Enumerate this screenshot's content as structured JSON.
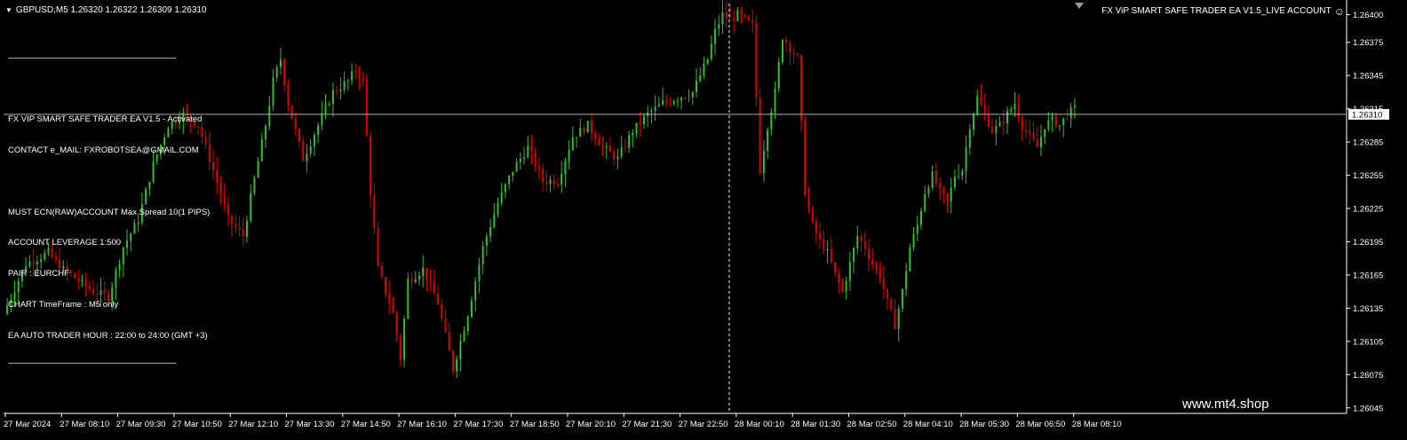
{
  "header": {
    "symbol_label": "GBPUSD,M5  1.26320 1.26322 1.26309 1.26310",
    "ea_title": "FX ViP SMART SAFE TRADER EA V1.5_LIVE ACCOUNT"
  },
  "info_panel": {
    "separator": "-----------------------------------------------------------------------",
    "lines": [
      "FX VIP SMART SAFE TRADER EA V1.5 - Activated",
      "CONTACT e_MAIL: FXROBOTSEA@GMAIL.COM",
      "",
      "MUST ECN(RAW)ACCOUNT Max Spread 10(1 PIPS)",
      "ACCOUNT LEVERAGE 1:500",
      "PAIR : EURCHF",
      "CHART TimeFrame : M5 only",
      "EA AUTO TRADER HOUR : 22:00 to 24:00 (GMT +3)"
    ]
  },
  "watermark": "www.mt4.shop",
  "colors": {
    "background": "#000000",
    "bull": "#2fbf2f",
    "bear": "#e00000",
    "axis": "#ffffff",
    "price_line": "#b4b4b4",
    "price_tag_bg": "#ffffff",
    "price_tag_text": "#000000"
  },
  "chart_data": {
    "type": "candlestick",
    "y_axis_labels": [
      "1.26400",
      "1.26375",
      "1.26345",
      "1.26315",
      "1.26285",
      "1.26255",
      "1.26225",
      "1.26195",
      "1.26165",
      "1.26135",
      "1.26105",
      "1.26075",
      "1.26045"
    ],
    "y_axis_values": [
      1.264,
      1.26375,
      1.26345,
      1.26315,
      1.26285,
      1.26255,
      1.26225,
      1.26195,
      1.26165,
      1.26135,
      1.26105,
      1.26075,
      1.26045
    ],
    "ylim": [
      1.2604,
      1.2641
    ],
    "current_price": 1.2631,
    "current_price_label": "1.26310",
    "x_axis_labels": [
      "27 Mar 2024",
      "27 Mar 08:10",
      "27 Mar 09:30",
      "27 Mar 10:50",
      "27 Mar 12:10",
      "27 Mar 13:30",
      "27 Mar 14:50",
      "27 Mar 16:10",
      "27 Mar 17:30",
      "27 Mar 18:50",
      "27 Mar 20:10",
      "27 Mar 21:30",
      "27 Mar 22:50",
      "28 Mar 00:10",
      "28 Mar 01:30",
      "28 Mar 02:50",
      "28 Mar 04:10",
      "28 Mar 05:30",
      "28 Mar 06:50",
      "28 Mar 08:10"
    ],
    "period_separator_label": "27 Mar 22:50",
    "close_path": [
      [
        0,
        1.2613
      ],
      [
        6,
        1.26175
      ],
      [
        12,
        1.26185
      ],
      [
        16,
        1.2617
      ],
      [
        20,
        1.2616
      ],
      [
        24,
        1.2615
      ],
      [
        28,
        1.26145
      ],
      [
        32,
        1.2619
      ],
      [
        36,
        1.26215
      ],
      [
        40,
        1.26265
      ],
      [
        44,
        1.263
      ],
      [
        48,
        1.2631
      ],
      [
        52,
        1.263
      ],
      [
        56,
        1.2626
      ],
      [
        60,
        1.26215
      ],
      [
        64,
        1.262
      ],
      [
        66,
        1.26235
      ],
      [
        70,
        1.263
      ],
      [
        72,
        1.2634
      ],
      [
        74,
        1.2636
      ],
      [
        76,
        1.2632
      ],
      [
        80,
        1.2627
      ],
      [
        84,
        1.263
      ],
      [
        88,
        1.2633
      ],
      [
        92,
        1.2634
      ],
      [
        94,
        1.2635
      ],
      [
        96,
        1.2634
      ],
      [
        98,
        1.2624
      ],
      [
        100,
        1.2617
      ],
      [
        102,
        1.2615
      ],
      [
        104,
        1.2613
      ],
      [
        106,
        1.2609
      ],
      [
        108,
        1.2616
      ],
      [
        112,
        1.2617
      ],
      [
        116,
        1.2614
      ],
      [
        118,
        1.2611
      ],
      [
        120,
        1.2608
      ],
      [
        124,
        1.2613
      ],
      [
        128,
        1.2619
      ],
      [
        132,
        1.2623
      ],
      [
        136,
        1.2626
      ],
      [
        140,
        1.2628
      ],
      [
        144,
        1.2625
      ],
      [
        148,
        1.2625
      ],
      [
        152,
        1.2629
      ],
      [
        156,
        1.263
      ],
      [
        160,
        1.2628
      ],
      [
        164,
        1.2627
      ],
      [
        168,
        1.26295
      ],
      [
        172,
        1.2631
      ],
      [
        176,
        1.2632
      ],
      [
        180,
        1.26325
      ],
      [
        184,
        1.2633
      ],
      [
        186,
        1.26345
      ],
      [
        188,
        1.2636
      ],
      [
        190,
        1.26385
      ],
      [
        192,
        1.264
      ],
      [
        194,
        1.26395
      ],
      [
        196,
        1.264
      ],
      [
        198,
        1.26395
      ],
      [
        200,
        1.2639
      ],
      [
        202,
        1.2626
      ],
      [
        204,
        1.263
      ],
      [
        206,
        1.2633
      ],
      [
        208,
        1.2638
      ],
      [
        210,
        1.2637
      ],
      [
        212,
        1.2636
      ],
      [
        214,
        1.2624
      ],
      [
        216,
        1.2621
      ],
      [
        218,
        1.26195
      ],
      [
        220,
        1.26185
      ],
      [
        222,
        1.26165
      ],
      [
        224,
        1.2615
      ],
      [
        226,
        1.26175
      ],
      [
        228,
        1.262
      ],
      [
        230,
        1.2619
      ],
      [
        232,
        1.26175
      ],
      [
        234,
        1.26165
      ],
      [
        236,
        1.2614
      ],
      [
        238,
        1.2612
      ],
      [
        240,
        1.2615
      ],
      [
        242,
        1.2619
      ],
      [
        244,
        1.2621
      ],
      [
        246,
        1.2624
      ],
      [
        248,
        1.26255
      ],
      [
        250,
        1.2624
      ],
      [
        252,
        1.2623
      ],
      [
        254,
        1.26255
      ],
      [
        256,
        1.2626
      ],
      [
        258,
        1.263
      ],
      [
        260,
        1.26325
      ],
      [
        262,
        1.2631
      ],
      [
        264,
        1.26295
      ],
      [
        266,
        1.263
      ],
      [
        268,
        1.2631
      ],
      [
        270,
        1.2632
      ],
      [
        272,
        1.263
      ],
      [
        274,
        1.2629
      ],
      [
        276,
        1.2628
      ],
      [
        278,
        1.263
      ],
      [
        280,
        1.26305
      ],
      [
        282,
        1.263
      ],
      [
        284,
        1.2631
      ],
      [
        286,
        1.26315
      ]
    ]
  }
}
